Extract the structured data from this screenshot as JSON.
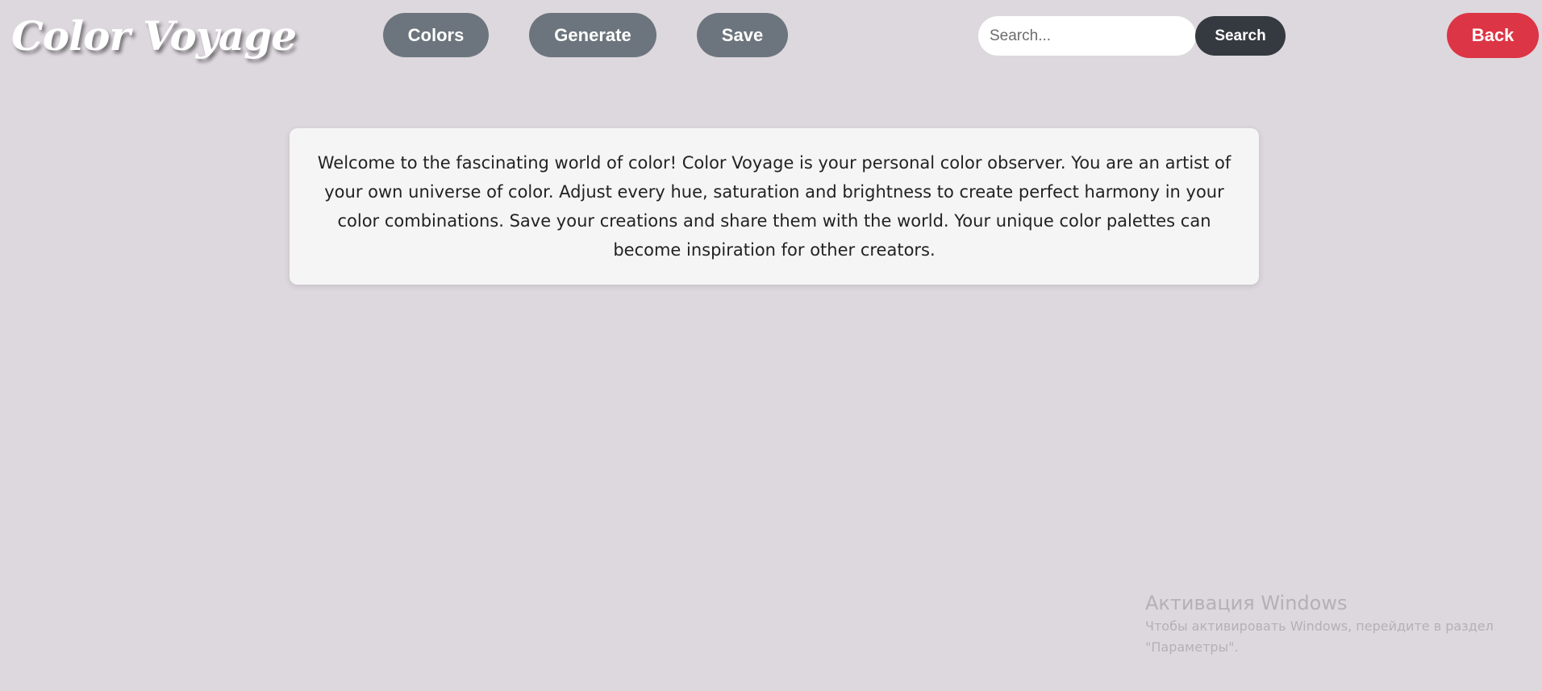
{
  "header": {
    "logo_text": "Color Voyage",
    "nav": {
      "colors_label": "Colors",
      "generate_label": "Generate",
      "save_label": "Save"
    },
    "search": {
      "placeholder": "Search...",
      "value": "",
      "button_label": "Search"
    },
    "back_label": "Back"
  },
  "main": {
    "welcome_text": "Welcome to the fascinating world of color! Color Voyage is your personal color observer. You are an artist of your own universe of color. Adjust every hue, saturation and brightness to create perfect harmony in your color combinations. Save your creations and share them with the world. Your unique color palettes can become inspiration for other creators."
  },
  "system_watermark": {
    "title": "Активация Windows",
    "subtitle": "Чтобы активировать Windows, перейдите в раздел \"Параметры\"."
  },
  "colors": {
    "background": "#ddd8de",
    "nav_button": "#6c757d",
    "search_button": "#343a40",
    "back_button": "#dc3545",
    "card": "#f5f5f5"
  }
}
